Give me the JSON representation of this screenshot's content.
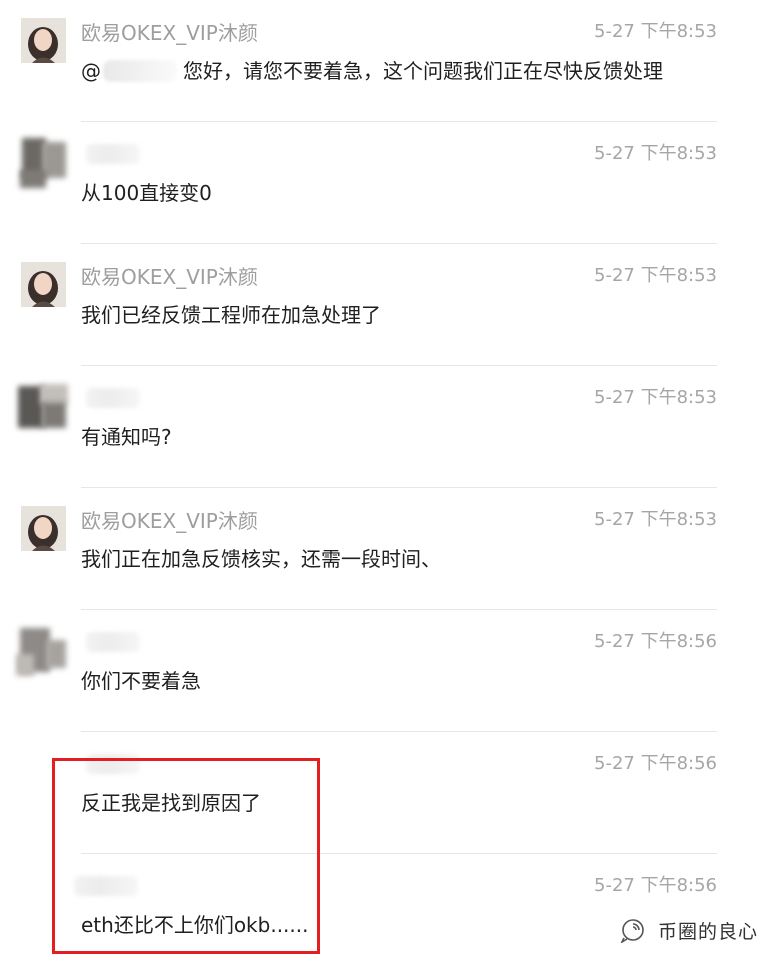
{
  "messages": [
    {
      "sender": "欧易OKEX_VIP沐颜",
      "official": true,
      "time": "5-27 下午8:53",
      "mention_prefix": "@",
      "text": "您好，请您不要着急，这个问题我们正在尽快反馈处理"
    },
    {
      "sender": "",
      "official": false,
      "time": "5-27 下午8:53",
      "text": "从100直接变0"
    },
    {
      "sender": "欧易OKEX_VIP沐颜",
      "official": true,
      "time": "5-27 下午8:53",
      "text": "我们已经反馈工程师在加急处理了"
    },
    {
      "sender": "",
      "official": false,
      "time": "5-27 下午8:53",
      "text": "有通知吗?"
    },
    {
      "sender": "欧易OKEX_VIP沐颜",
      "official": true,
      "time": "5-27 下午8:53",
      "text": "我们正在加急反馈核实，还需一段时间、"
    },
    {
      "sender": "",
      "official": false,
      "time": "5-27 下午8:56",
      "text": "你们不要着急"
    },
    {
      "sender": "",
      "official": false,
      "time": "5-27 下午8:56",
      "text": "反正我是找到原因了"
    },
    {
      "sender": "",
      "official": false,
      "time": "5-27 下午8:56",
      "text": "eth还比不上你们okb......"
    }
  ],
  "watermark": {
    "text": "币圈的良心",
    "icon": "wechat-official-account-icon"
  },
  "colors": {
    "highlight": "#e51f1f",
    "time": "#a6a6a6",
    "sender": "#9e9e9e",
    "divider": "#e6e6e6"
  }
}
